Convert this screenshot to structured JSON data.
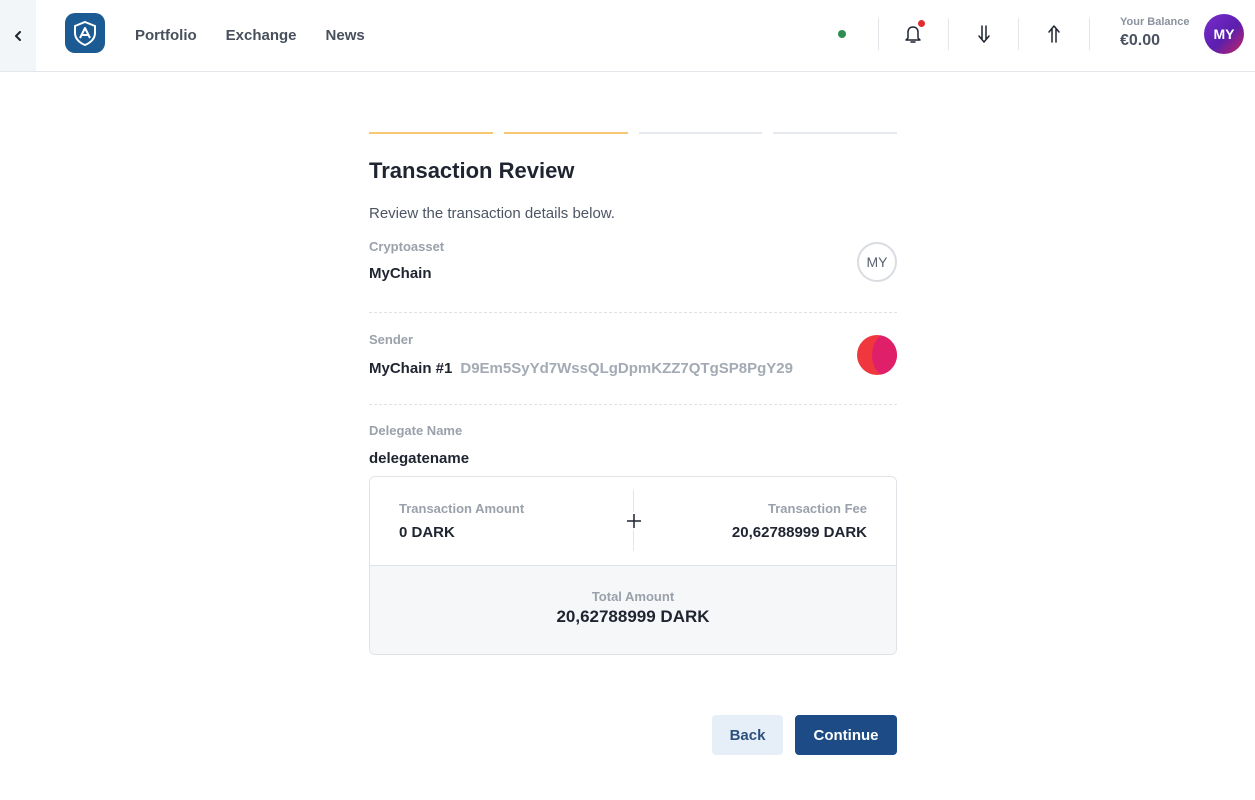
{
  "header": {
    "nav": [
      {
        "label": "Portfolio"
      },
      {
        "label": "Exchange"
      },
      {
        "label": "News"
      }
    ],
    "balance_label": "Your Balance",
    "balance_value": "€0.00",
    "avatar_initials": "MY",
    "icons": [
      "chevron-left-icon",
      "logo-icon",
      "status-dot",
      "bell-icon",
      "receive-icon",
      "send-icon"
    ],
    "colors": {
      "accent": "#1c4b86",
      "status_online": "#2f8e4f",
      "notification": "#e02d2d",
      "step_active": "#f7c874"
    }
  },
  "wizard": {
    "steps_total": 4,
    "steps_completed": 2
  },
  "review": {
    "title": "Transaction Review",
    "subtitle": "Review the transaction details below.",
    "crypto_label": "Cryptoasset",
    "crypto_value": "MyChain",
    "crypto_badge": "MY",
    "sender_label": "Sender",
    "sender_name": "MyChain #1",
    "sender_address": "D9Em5SyYd7WssQLgDpmKZZ7QTgSP8PgY29",
    "delegate_label": "Delegate Name",
    "delegate_value": "delegatename"
  },
  "summary": {
    "amount_label": "Transaction Amount",
    "amount_value": "0 DARK",
    "fee_label": "Transaction Fee",
    "fee_value": "20,62788999 DARK",
    "total_label": "Total Amount",
    "total_value": "20,62788999 DARK"
  },
  "actions": {
    "back_label": "Back",
    "continue_label": "Continue"
  }
}
